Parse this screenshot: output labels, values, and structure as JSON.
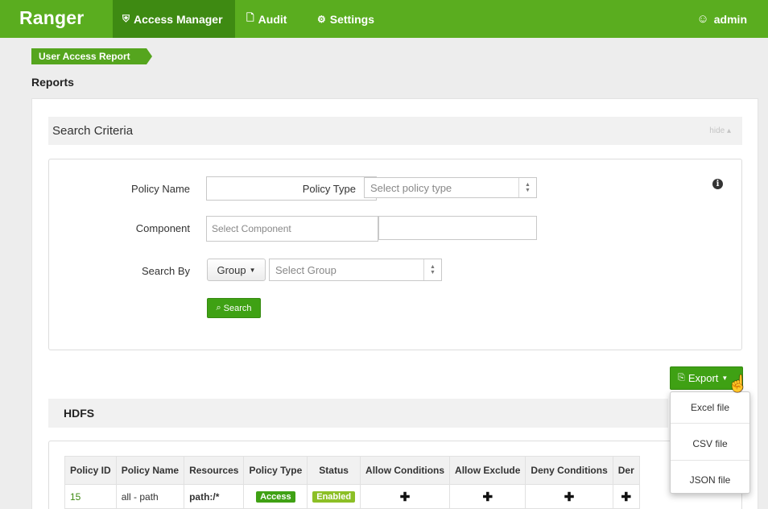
{
  "nav": {
    "brand": "Ranger",
    "items": [
      {
        "label": "Access Manager",
        "icon": "shield-icon"
      },
      {
        "label": "Audit",
        "icon": "file-icon"
      },
      {
        "label": "Settings",
        "icon": "gear-icon"
      }
    ],
    "user": "admin"
  },
  "breadcrumb": "User Access Report",
  "page_title": "Reports",
  "search_criteria": {
    "title": "Search Criteria",
    "hide_label": "hide",
    "policy_name_label": "Policy Name",
    "policy_type_label": "Policy Type",
    "policy_type_placeholder": "Select policy type",
    "component_label": "Component",
    "component_placeholder": "Select Component",
    "search_by_label": "Search By",
    "search_by_value": "Group",
    "group_placeholder": "Select Group",
    "search_button": "Search"
  },
  "export": {
    "label": "Export",
    "options": [
      "Excel file",
      "CSV file",
      "JSON file"
    ]
  },
  "hdfs": {
    "title": "HDFS",
    "columns": [
      "Policy ID",
      "Policy Name",
      "Resources",
      "Policy Type",
      "Status",
      "Allow Conditions",
      "Allow Exclude",
      "Deny Conditions",
      "Der"
    ],
    "rows": [
      {
        "policy_id": "15",
        "policy_name": "all - path",
        "resources": "path:/*",
        "policy_type": "Access",
        "status": "Enabled"
      }
    ]
  },
  "colors": {
    "brand_green": "#5aad1f",
    "active_tab": "#3e8a12",
    "button_green": "#3fa114"
  }
}
